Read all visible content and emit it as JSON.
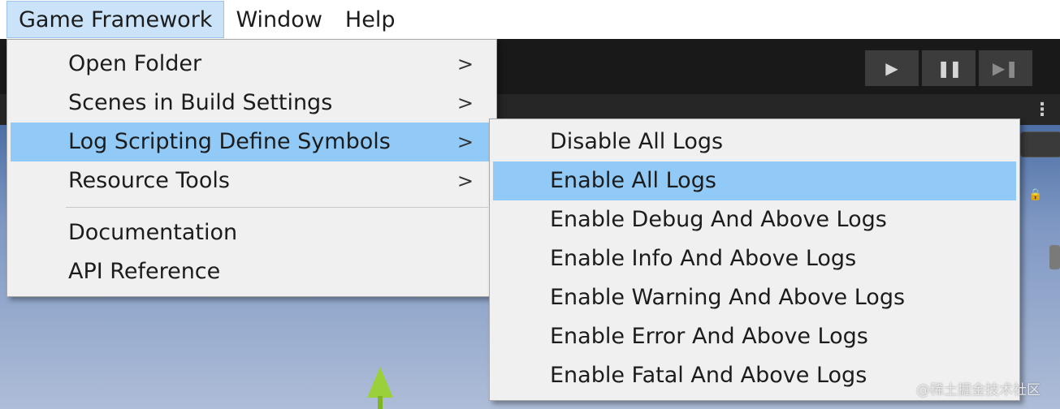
{
  "menubar": {
    "items": [
      "Game Framework",
      "Window",
      "Help"
    ]
  },
  "main_menu": {
    "items": [
      {
        "label": "Open Folder",
        "submenu": true
      },
      {
        "label": "Scenes in Build Settings",
        "submenu": true
      },
      {
        "label": "Log Scripting Define Symbols",
        "submenu": true
      },
      {
        "label": "Resource Tools",
        "submenu": true
      },
      {
        "label": "Documentation",
        "submenu": false
      },
      {
        "label": "API Reference",
        "submenu": false
      }
    ],
    "arrow_glyph": ">",
    "highlighted": "Log Scripting Define Symbols"
  },
  "sub_menu": {
    "items": [
      "Disable All Logs",
      "Enable All Logs",
      "Enable Debug And Above Logs",
      "Enable Info And Above Logs",
      "Enable Warning And Above Logs",
      "Enable Error And Above Logs",
      "Enable Fatal And Above Logs"
    ],
    "highlighted": "Enable All Logs"
  },
  "toolbar": {
    "play_icon": "play-icon",
    "pause_icon": "pause-icon",
    "step_icon": "step-icon"
  },
  "watermark": "@稀土掘金技术社区",
  "colors": {
    "menu_bg": "#f0f0f0",
    "highlight": "#91c9f7",
    "menubar_active": "#cbe3f8"
  }
}
